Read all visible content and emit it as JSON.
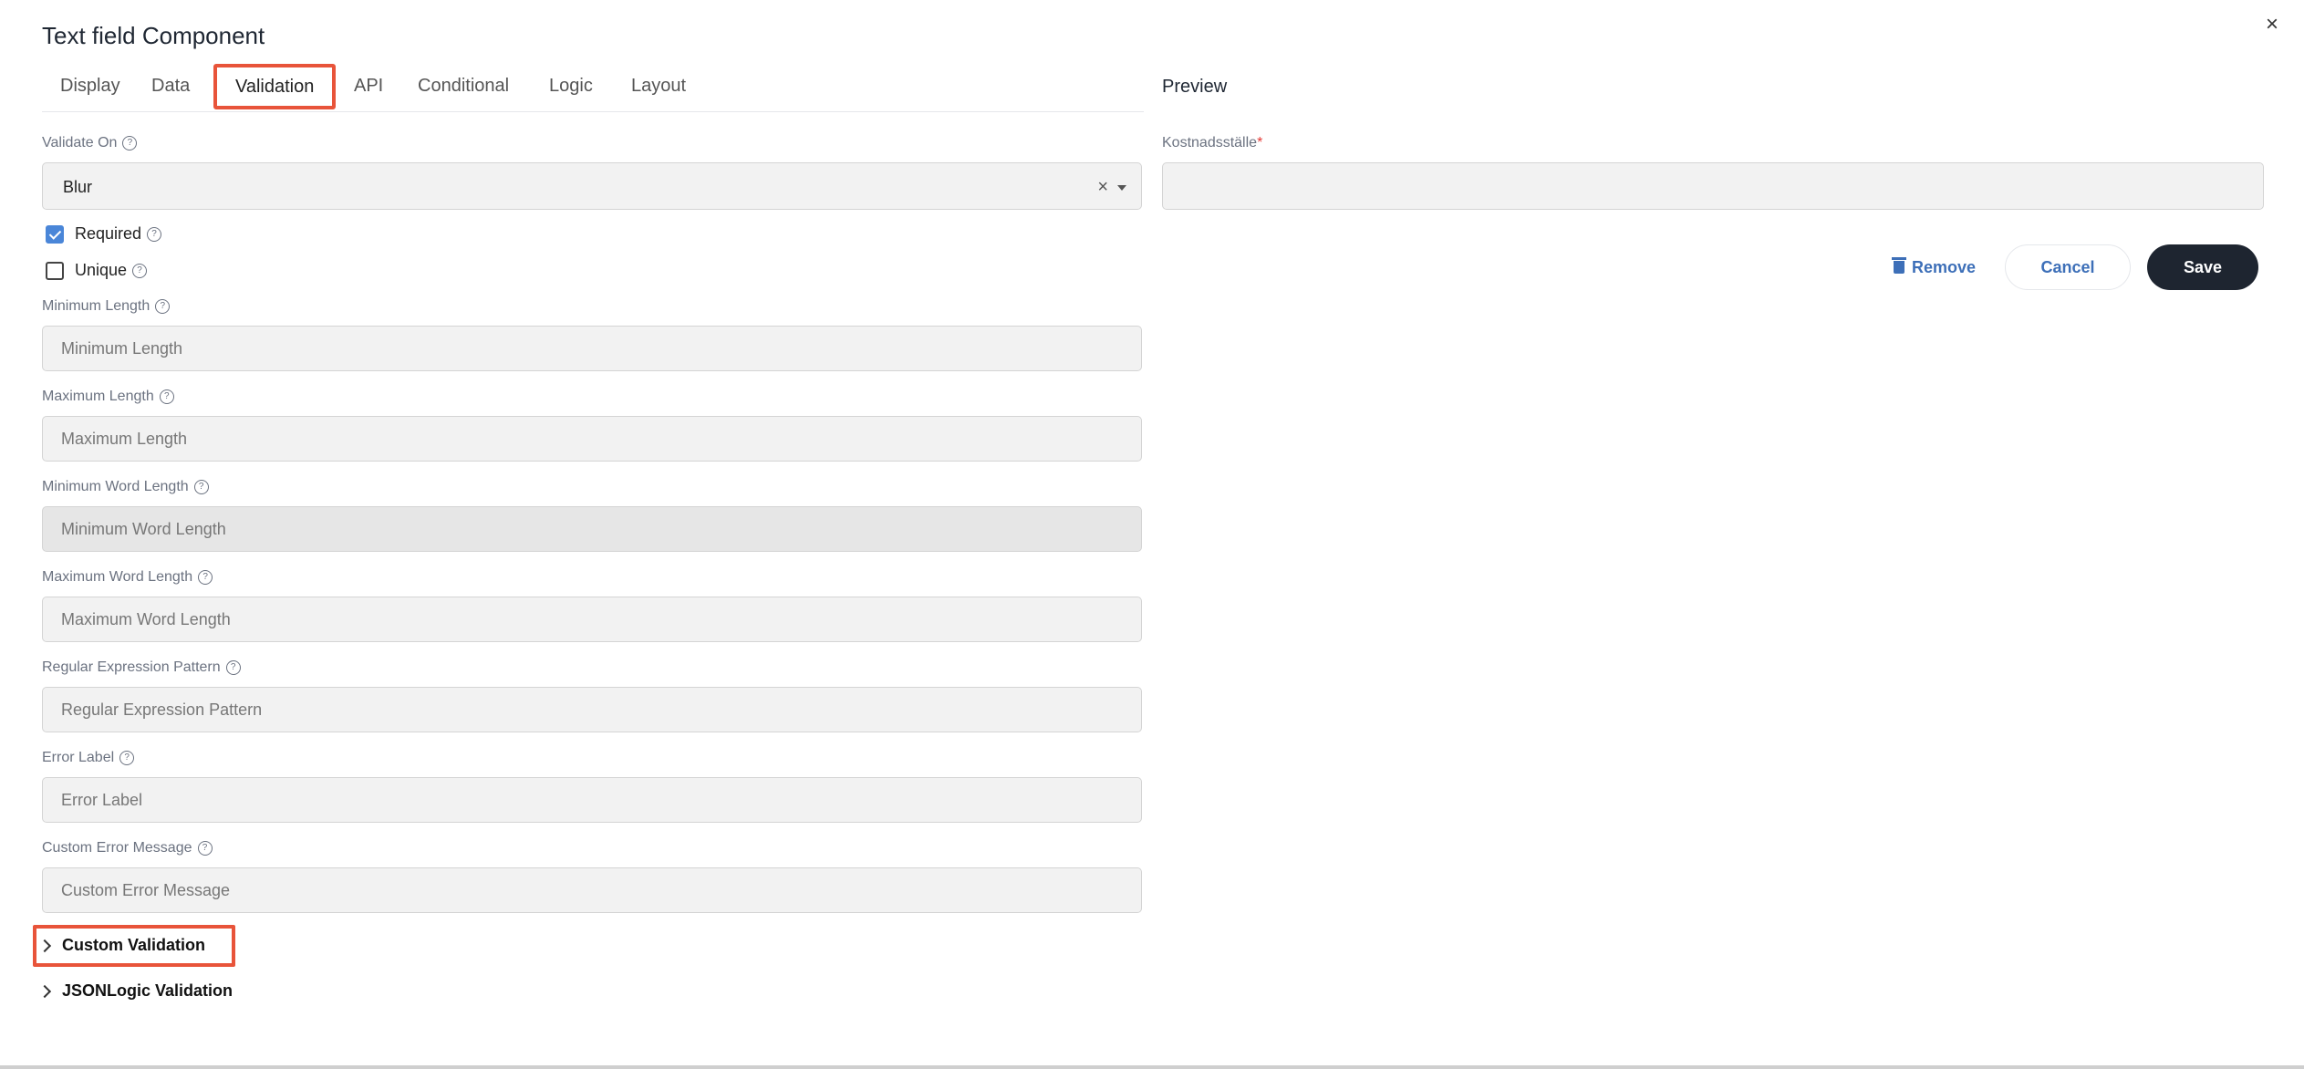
{
  "dialog": {
    "title": "Text field Component"
  },
  "tabs": [
    {
      "label": "Display"
    },
    {
      "label": "Data"
    },
    {
      "label": "Validation"
    },
    {
      "label": "API"
    },
    {
      "label": "Conditional"
    },
    {
      "label": "Logic"
    },
    {
      "label": "Layout"
    }
  ],
  "validate_on": {
    "label": "Validate On",
    "value": "Blur",
    "clear": "×"
  },
  "required": {
    "label": "Required",
    "checked": true
  },
  "unique": {
    "label": "Unique",
    "checked": false
  },
  "fields": {
    "min_length": {
      "label": "Minimum Length",
      "placeholder": "Minimum Length"
    },
    "max_length": {
      "label": "Maximum Length",
      "placeholder": "Maximum Length"
    },
    "min_word_length": {
      "label": "Minimum Word Length",
      "placeholder": "Minimum Word Length"
    },
    "max_word_length": {
      "label": "Maximum Word Length",
      "placeholder": "Maximum Word Length"
    },
    "regex": {
      "label": "Regular Expression Pattern",
      "placeholder": "Regular Expression Pattern"
    },
    "error_label": {
      "label": "Error Label",
      "placeholder": "Error Label"
    },
    "custom_error": {
      "label": "Custom Error Message",
      "placeholder": "Custom Error Message"
    }
  },
  "sections": {
    "custom_validation": "Custom Validation",
    "jsonlogic_validation": "JSONLogic Validation"
  },
  "preview": {
    "title": "Preview",
    "field_label": "Kostnadsställe",
    "required_mark": "*"
  },
  "actions": {
    "remove": "Remove",
    "cancel": "Cancel",
    "save": "Save"
  },
  "close_label": "×",
  "help_glyph": "?",
  "colors": {
    "highlight": "#e8543a",
    "accent": "#3d6fb8",
    "save_bg": "#1e2530",
    "checkbox": "#4a86d8"
  }
}
